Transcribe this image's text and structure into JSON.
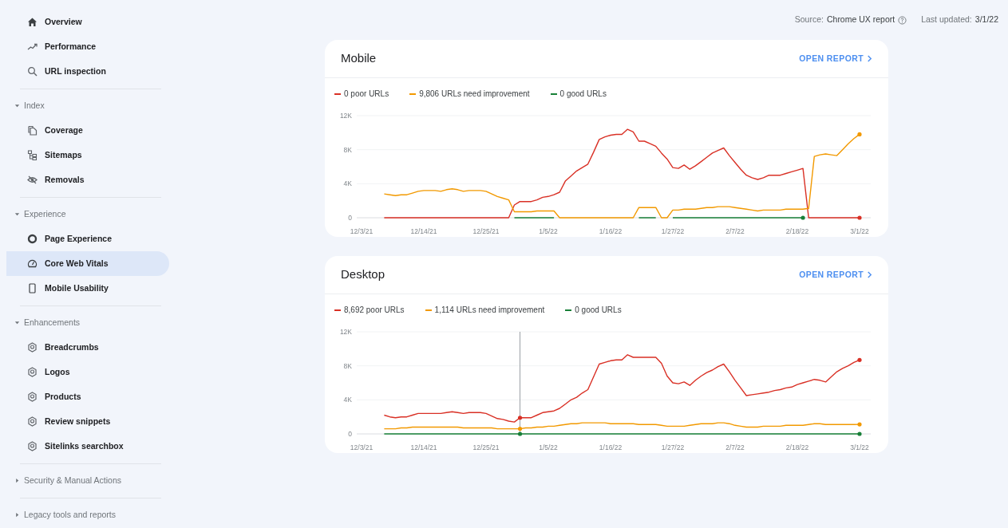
{
  "sidebar": {
    "sections": [
      {
        "items": [
          {
            "label": "Overview",
            "kind": "house",
            "selected": false
          },
          {
            "label": "Performance",
            "kind": "trend",
            "selected": false
          },
          {
            "label": "URL inspection",
            "kind": "search",
            "selected": false
          }
        ]
      },
      {
        "title": "Index",
        "expanded": true,
        "items": [
          {
            "label": "Coverage",
            "kind": "pages",
            "selected": false
          },
          {
            "label": "Sitemaps",
            "kind": "sitemap",
            "selected": false
          },
          {
            "label": "Removals",
            "kind": "eye-off",
            "selected": false
          }
        ]
      },
      {
        "title": "Experience",
        "expanded": true,
        "items": [
          {
            "label": "Page Experience",
            "kind": "ring",
            "selected": false
          },
          {
            "label": "Core Web Vitals",
            "kind": "gauge",
            "selected": true
          },
          {
            "label": "Mobile Usability",
            "kind": "phone",
            "selected": false
          }
        ]
      },
      {
        "title": "Enhancements",
        "expanded": true,
        "items": [
          {
            "label": "Breadcrumbs",
            "kind": "badge",
            "selected": false
          },
          {
            "label": "Logos",
            "kind": "badge",
            "selected": false
          },
          {
            "label": "Products",
            "kind": "badge",
            "selected": false
          },
          {
            "label": "Review snippets",
            "kind": "badge",
            "selected": false
          },
          {
            "label": "Sitelinks searchbox",
            "kind": "badge",
            "selected": false
          }
        ]
      },
      {
        "title": "Security & Manual Actions",
        "expanded": false
      },
      {
        "title": "Legacy tools and reports",
        "expanded": false
      }
    ]
  },
  "header": {
    "source_label": "Source:",
    "source": "Chrome UX report",
    "updated_label": "Last updated:",
    "updated": "3/1/22"
  },
  "cards": [
    {
      "title": "Mobile",
      "link": "OPEN REPORT",
      "chart_data": {
        "type": "line",
        "ylim": [
          0,
          12000
        ],
        "categories": [
          "12/3/21",
          null,
          null,
          null,
          null,
          null,
          null,
          null,
          null,
          null,
          null,
          "12/14/21",
          null,
          null,
          null,
          null,
          null,
          null,
          null,
          null,
          null,
          null,
          "12/25/21",
          null,
          null,
          null,
          null,
          null,
          null,
          null,
          null,
          null,
          null,
          "1/5/22",
          null,
          null,
          null,
          null,
          null,
          null,
          null,
          null,
          null,
          null,
          "1/16/22",
          null,
          null,
          null,
          null,
          null,
          null,
          null,
          null,
          null,
          null,
          "1/27/22",
          null,
          null,
          null,
          null,
          null,
          null,
          null,
          null,
          null,
          null,
          "2/7/22",
          null,
          null,
          null,
          null,
          null,
          null,
          null,
          null,
          null,
          null,
          "2/18/22",
          null,
          null,
          null,
          null,
          null,
          null,
          null,
          null,
          null,
          null,
          "3/1/22"
        ],
        "yticks": [
          {
            "value": 0,
            "label": "0"
          },
          {
            "value": 4000,
            "label": "4K"
          },
          {
            "value": 8000,
            "label": "8K"
          },
          {
            "value": 12000,
            "label": "12K"
          }
        ],
        "series": [
          {
            "name": "0 poor URLs",
            "color": "#d93025",
            "values": [
              null,
              null,
              null,
              null,
              0,
              0,
              0,
              0,
              0,
              0,
              0,
              0,
              0,
              0,
              0,
              0,
              0,
              0,
              0,
              0,
              0,
              0,
              0,
              0,
              0,
              0,
              0,
              1500,
              1900,
              1900,
              1900,
              2100,
              2400,
              2500,
              2700,
              3000,
              4300,
              4900,
              5500,
              5900,
              6300,
              7700,
              9200,
              9500,
              9700,
              9800,
              9800,
              10400,
              10100,
              9000,
              9000,
              8700,
              8400,
              7600,
              6900,
              5900,
              5800,
              6200,
              5700,
              6100,
              6600,
              7100,
              7600,
              7900,
              8200,
              7300,
              6500,
              5700,
              5000,
              4700,
              4500,
              4700,
              5000,
              5000,
              5000,
              5200,
              5400,
              5600,
              5800,
              0,
              0,
              0,
              0,
              0,
              0,
              0,
              0,
              0,
              0
            ]
          },
          {
            "name": "9,806 URLs need improvement",
            "color": "#f29900",
            "values": [
              null,
              null,
              null,
              null,
              2800,
              2700,
              2600,
              2700,
              2700,
              2900,
              3100,
              3200,
              3200,
              3200,
              3100,
              3300,
              3400,
              3300,
              3100,
              3200,
              3200,
              3200,
              3100,
              2800,
              2500,
              2300,
              2100,
              700,
              700,
              700,
              700,
              800,
              800,
              800,
              800,
              0,
              0,
              0,
              0,
              0,
              0,
              0,
              0,
              0,
              0,
              0,
              0,
              0,
              0,
              1200,
              1200,
              1200,
              1200,
              0,
              0,
              900,
              900,
              1000,
              1000,
              1000,
              1100,
              1200,
              1200,
              1300,
              1300,
              1300,
              1200,
              1100,
              1000,
              900,
              800,
              900,
              900,
              900,
              900,
              1000,
              1000,
              1000,
              1000,
              1100,
              7200,
              7400,
              7500,
              7400,
              7300,
              8000,
              8700,
              9300,
              9806
            ]
          },
          {
            "name": "0 good URLs",
            "color": "#188038",
            "values": [
              null,
              null,
              null,
              null,
              null,
              null,
              null,
              null,
              null,
              null,
              null,
              null,
              null,
              null,
              null,
              null,
              null,
              null,
              null,
              null,
              null,
              null,
              null,
              null,
              null,
              null,
              null,
              0,
              0,
              0,
              0,
              0,
              0,
              0,
              0,
              null,
              null,
              null,
              null,
              null,
              null,
              null,
              null,
              null,
              null,
              null,
              null,
              null,
              null,
              0,
              0,
              0,
              0,
              null,
              null,
              0,
              0,
              0,
              0,
              0,
              0,
              0,
              0,
              0,
              0,
              0,
              0,
              0,
              0,
              0,
              0,
              0,
              0,
              0,
              0,
              0,
              0,
              0,
              0,
              null,
              null,
              null,
              null,
              null,
              null,
              null,
              null,
              null,
              null
            ]
          }
        ]
      }
    },
    {
      "title": "Desktop",
      "link": "OPEN REPORT",
      "cursor": true,
      "chart_data": {
        "type": "line",
        "ylim": [
          0,
          12000
        ],
        "categories": [
          "12/3/21",
          null,
          null,
          null,
          null,
          null,
          null,
          null,
          null,
          null,
          null,
          "12/14/21",
          null,
          null,
          null,
          null,
          null,
          null,
          null,
          null,
          null,
          null,
          "12/25/21",
          null,
          null,
          null,
          null,
          null,
          null,
          null,
          null,
          null,
          null,
          "1/5/22",
          null,
          null,
          null,
          null,
          null,
          null,
          null,
          null,
          null,
          null,
          "1/16/22",
          null,
          null,
          null,
          null,
          null,
          null,
          null,
          null,
          null,
          null,
          "1/27/22",
          null,
          null,
          null,
          null,
          null,
          null,
          null,
          null,
          null,
          null,
          "2/7/22",
          null,
          null,
          null,
          null,
          null,
          null,
          null,
          null,
          null,
          null,
          "2/18/22",
          null,
          null,
          null,
          null,
          null,
          null,
          null,
          null,
          null,
          null,
          "3/1/22"
        ],
        "yticks": [
          {
            "value": 0,
            "label": "0"
          },
          {
            "value": 4000,
            "label": "4K"
          },
          {
            "value": 8000,
            "label": "8K"
          },
          {
            "value": 12000,
            "label": "12K"
          }
        ],
        "series": [
          {
            "name": "8,692 poor URLs",
            "color": "#d93025",
            "values": [
              null,
              null,
              null,
              null,
              2200,
              2000,
              1900,
              2000,
              2000,
              2200,
              2400,
              2400,
              2400,
              2400,
              2400,
              2500,
              2600,
              2500,
              2400,
              2500,
              2500,
              2500,
              2400,
              2100,
              1800,
              1700,
              1500,
              1400,
              1900,
              1900,
              1900,
              2200,
              2500,
              2600,
              2700,
              3000,
              3500,
              4000,
              4300,
              4800,
              5200,
              6700,
              8200,
              8400,
              8600,
              8700,
              8700,
              9300,
              9000,
              9000,
              9000,
              9000,
              9000,
              8300,
              6800,
              6000,
              5900,
              6100,
              5700,
              6300,
              6800,
              7200,
              7500,
              7900,
              8200,
              7300,
              6300,
              5400,
              4500,
              4600,
              4700,
              4800,
              4900,
              5100,
              5200,
              5400,
              5500,
              5800,
              6000,
              6200,
              6400,
              6300,
              6100,
              6700,
              7300,
              7700,
              8000,
              8400,
              8692
            ]
          },
          {
            "name": "1,114 URLs need improvement",
            "color": "#f29900",
            "values": [
              null,
              null,
              null,
              null,
              600,
              600,
              600,
              700,
              700,
              800,
              800,
              800,
              800,
              800,
              800,
              800,
              800,
              800,
              700,
              700,
              700,
              700,
              700,
              700,
              600,
              600,
              600,
              600,
              600,
              700,
              700,
              800,
              800,
              900,
              900,
              1000,
              1100,
              1200,
              1200,
              1300,
              1300,
              1300,
              1300,
              1300,
              1200,
              1200,
              1200,
              1200,
              1200,
              1100,
              1100,
              1100,
              1100,
              1000,
              900,
              900,
              900,
              900,
              1000,
              1100,
              1200,
              1200,
              1200,
              1300,
              1300,
              1200,
              1000,
              900,
              800,
              800,
              800,
              900,
              900,
              900,
              900,
              1000,
              1000,
              1000,
              1000,
              1100,
              1200,
              1200,
              1100,
              1100,
              1100,
              1100,
              1100,
              1100,
              1114
            ]
          },
          {
            "name": "0 good URLs",
            "color": "#188038",
            "values": [
              null,
              null,
              null,
              null,
              0,
              0,
              0,
              0,
              0,
              0,
              0,
              0,
              0,
              0,
              0,
              0,
              0,
              0,
              0,
              0,
              0,
              0,
              0,
              0,
              0,
              0,
              0,
              0,
              0,
              0,
              0,
              0,
              0,
              0,
              0,
              0,
              0,
              0,
              0,
              0,
              0,
              0,
              0,
              0,
              0,
              0,
              0,
              0,
              0,
              0,
              0,
              0,
              0,
              0,
              0,
              0,
              0,
              0,
              0,
              0,
              0,
              0,
              0,
              0,
              0,
              0,
              0,
              0,
              0,
              0,
              0,
              0,
              0,
              0,
              0,
              0,
              0,
              0,
              0,
              0,
              0,
              0,
              0,
              0,
              0,
              0,
              0,
              0,
              0
            ]
          }
        ]
      }
    }
  ]
}
